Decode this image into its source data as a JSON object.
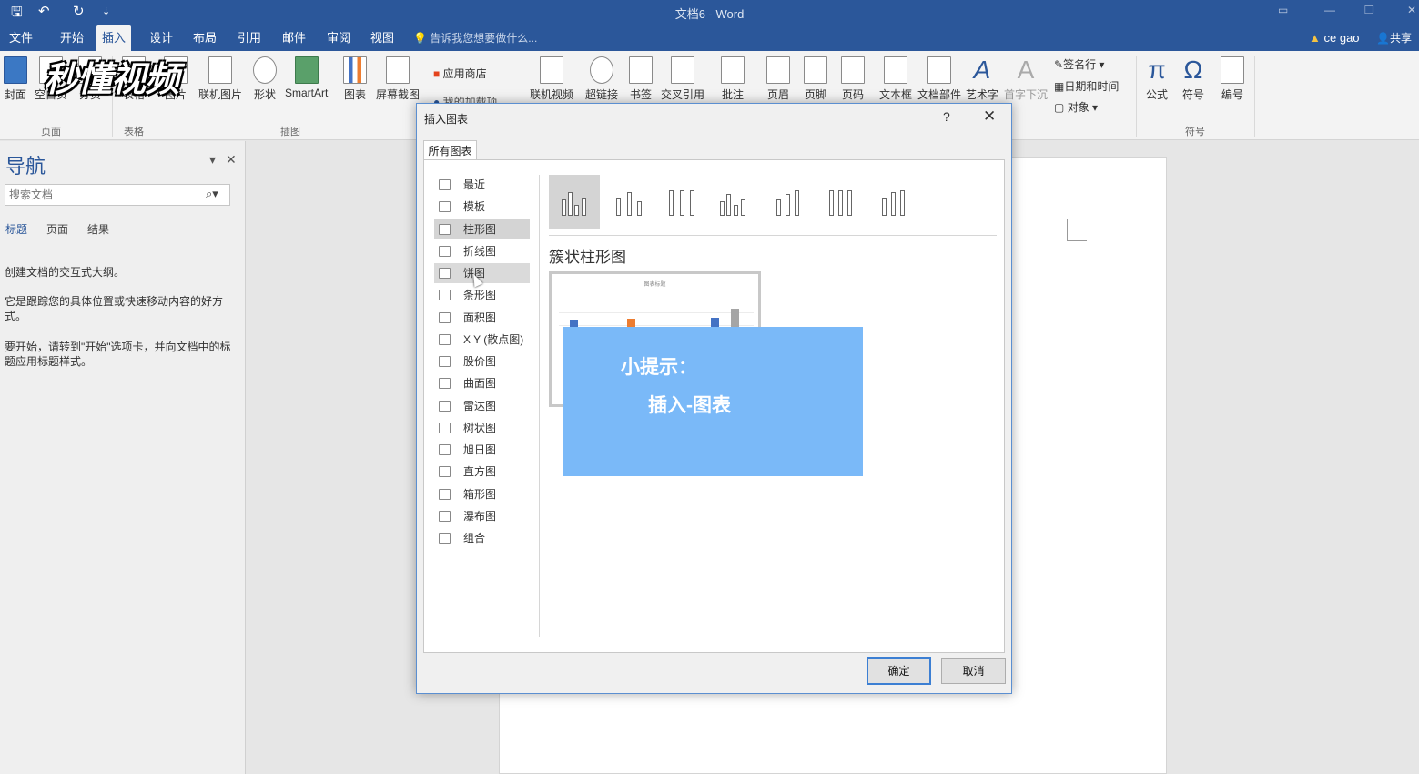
{
  "titlebar": {
    "title": "文档6 - Word",
    "undo_glyph": "↶",
    "redo_glyph": "↻",
    "save_glyph": "🖫",
    "more_glyph": "⇣"
  },
  "tabs": [
    "文件",
    "开始",
    "插入",
    "设计",
    "布局",
    "引用",
    "邮件",
    "审阅",
    "视图"
  ],
  "active_tab": "插入",
  "tell_me": "告诉我您想要做什么...",
  "user": "ce gao",
  "share": "共享",
  "ribbon": {
    "pages": [
      "封面",
      "空白页",
      "分页"
    ],
    "table": "表格",
    "illustrations": [
      "图片",
      "联机图片",
      "形状",
      "SmartArt",
      "图表",
      "屏幕截图"
    ],
    "addins": [
      "应用商店",
      "我的加载项"
    ],
    "media": "联机视频",
    "links": [
      "超链接",
      "书签",
      "交叉引用"
    ],
    "comment": "批注",
    "header_footer": [
      "页眉",
      "页脚",
      "页码"
    ],
    "text": [
      "文本框",
      "文档部件",
      "艺术字",
      "首字下沉"
    ],
    "text_small": [
      "签名行",
      "日期和时间",
      "对象"
    ],
    "symbols": [
      "公式",
      "符号",
      "编号"
    ],
    "groups": [
      "页面",
      "表格",
      "插图",
      "符号"
    ]
  },
  "watermark": "秒懂视频",
  "nav": {
    "title": "导航",
    "search_placeholder": "搜索文档",
    "tabs": [
      "标题",
      "页面",
      "结果"
    ],
    "p1": "创建文档的交互式大纲。",
    "p2": "它是跟踪您的具体位置或快速移动内容的好方式。",
    "p3": "要开始，请转到\"开始\"选项卡，并向文档中的标题应用标题样式。"
  },
  "dialog": {
    "title": "插入图表",
    "help": "?",
    "close": "✕",
    "tab": "所有图表",
    "categories": [
      "最近",
      "模板",
      "柱形图",
      "折线图",
      "饼图",
      "条形图",
      "面积图",
      "X Y (散点图)",
      "股价图",
      "曲面图",
      "雷达图",
      "树状图",
      "旭日图",
      "直方图",
      "箱形图",
      "瀑布图",
      "组合"
    ],
    "selected_category": "柱形图",
    "hover_category": "饼图",
    "subtype_title": "簇状柱形图",
    "preview_title": "图表标题",
    "ok": "确定",
    "cancel": "取消"
  },
  "overlay": {
    "line1": "小提示：",
    "line2": "插入-图表"
  },
  "colors": {
    "accent": "#2b579a",
    "overlay": "#7ab9f8",
    "bar_blue": "#4472c4",
    "bar_orange": "#ed7d31",
    "bar_gray": "#a5a5a5"
  }
}
